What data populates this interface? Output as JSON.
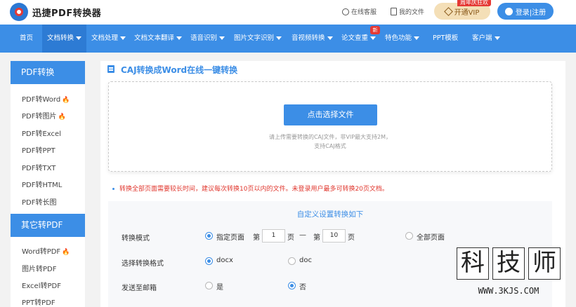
{
  "header": {
    "logo_text": "迅捷PDF转换器",
    "service_label": "在线客服",
    "my_files_label": "我的文件",
    "vip_badge": "周年庆狂欢",
    "vip_label": "开通VIP",
    "login_label": "登录|注册"
  },
  "nav": {
    "items": [
      {
        "label": "首页"
      },
      {
        "label": "文档转换"
      },
      {
        "label": "文档处理"
      },
      {
        "label": "文档文本翻译"
      },
      {
        "label": "语音识别"
      },
      {
        "label": "图片文字识别"
      },
      {
        "label": "音视频转换"
      },
      {
        "label": "论文查重"
      },
      {
        "label": "特色功能"
      },
      {
        "label": "PPT模板"
      },
      {
        "label": "客户端"
      }
    ],
    "new_badge": "新"
  },
  "sidebar": {
    "section1_title": "PDF转换",
    "section1_items": [
      {
        "label": "PDF转Word",
        "hot": "🔥"
      },
      {
        "label": "PDF转图片",
        "hot": "🔥"
      },
      {
        "label": "PDF转Excel"
      },
      {
        "label": "PDF转PPT"
      },
      {
        "label": "PDF转TXT"
      },
      {
        "label": "PDF转HTML"
      },
      {
        "label": "PDF转长图"
      }
    ],
    "section2_title": "其它转PDF",
    "section2_items": [
      {
        "label": "Word转PDF",
        "hot": "🔥"
      },
      {
        "label": "图片转PDF"
      },
      {
        "label": "Excel转PDF"
      },
      {
        "label": "PPT转PDF"
      }
    ]
  },
  "main": {
    "title": "CAJ转换成Word在线一键转换",
    "select_button": "点击选择文件",
    "hint_line1": "请上传需要转换的CAJ文件，非VIP最大支持2M，",
    "hint_line2": "支持CAJ格式",
    "notice": "转换全部页面需要较长时间，建议每次转换10页以内的文件。未登录用户最多可转换20页文档。"
  },
  "settings": {
    "title": "自定义设置转换如下",
    "mode_label": "转换模式",
    "mode_specific": "指定页面",
    "page_from_prefix": "第",
    "page_from_value": "1",
    "page_unit": "页",
    "dash": "—",
    "page_to_prefix": "第",
    "page_to_value": "10",
    "mode_all": "全部页面",
    "format_label": "选择转换格式",
    "format_docx": "docx",
    "format_doc": "doc",
    "email_label": "发送至邮箱",
    "email_yes": "是",
    "email_no": "否"
  },
  "watermark": {
    "chars": [
      "科",
      "技",
      "师"
    ],
    "url": "WWW.3KJS.COM"
  }
}
